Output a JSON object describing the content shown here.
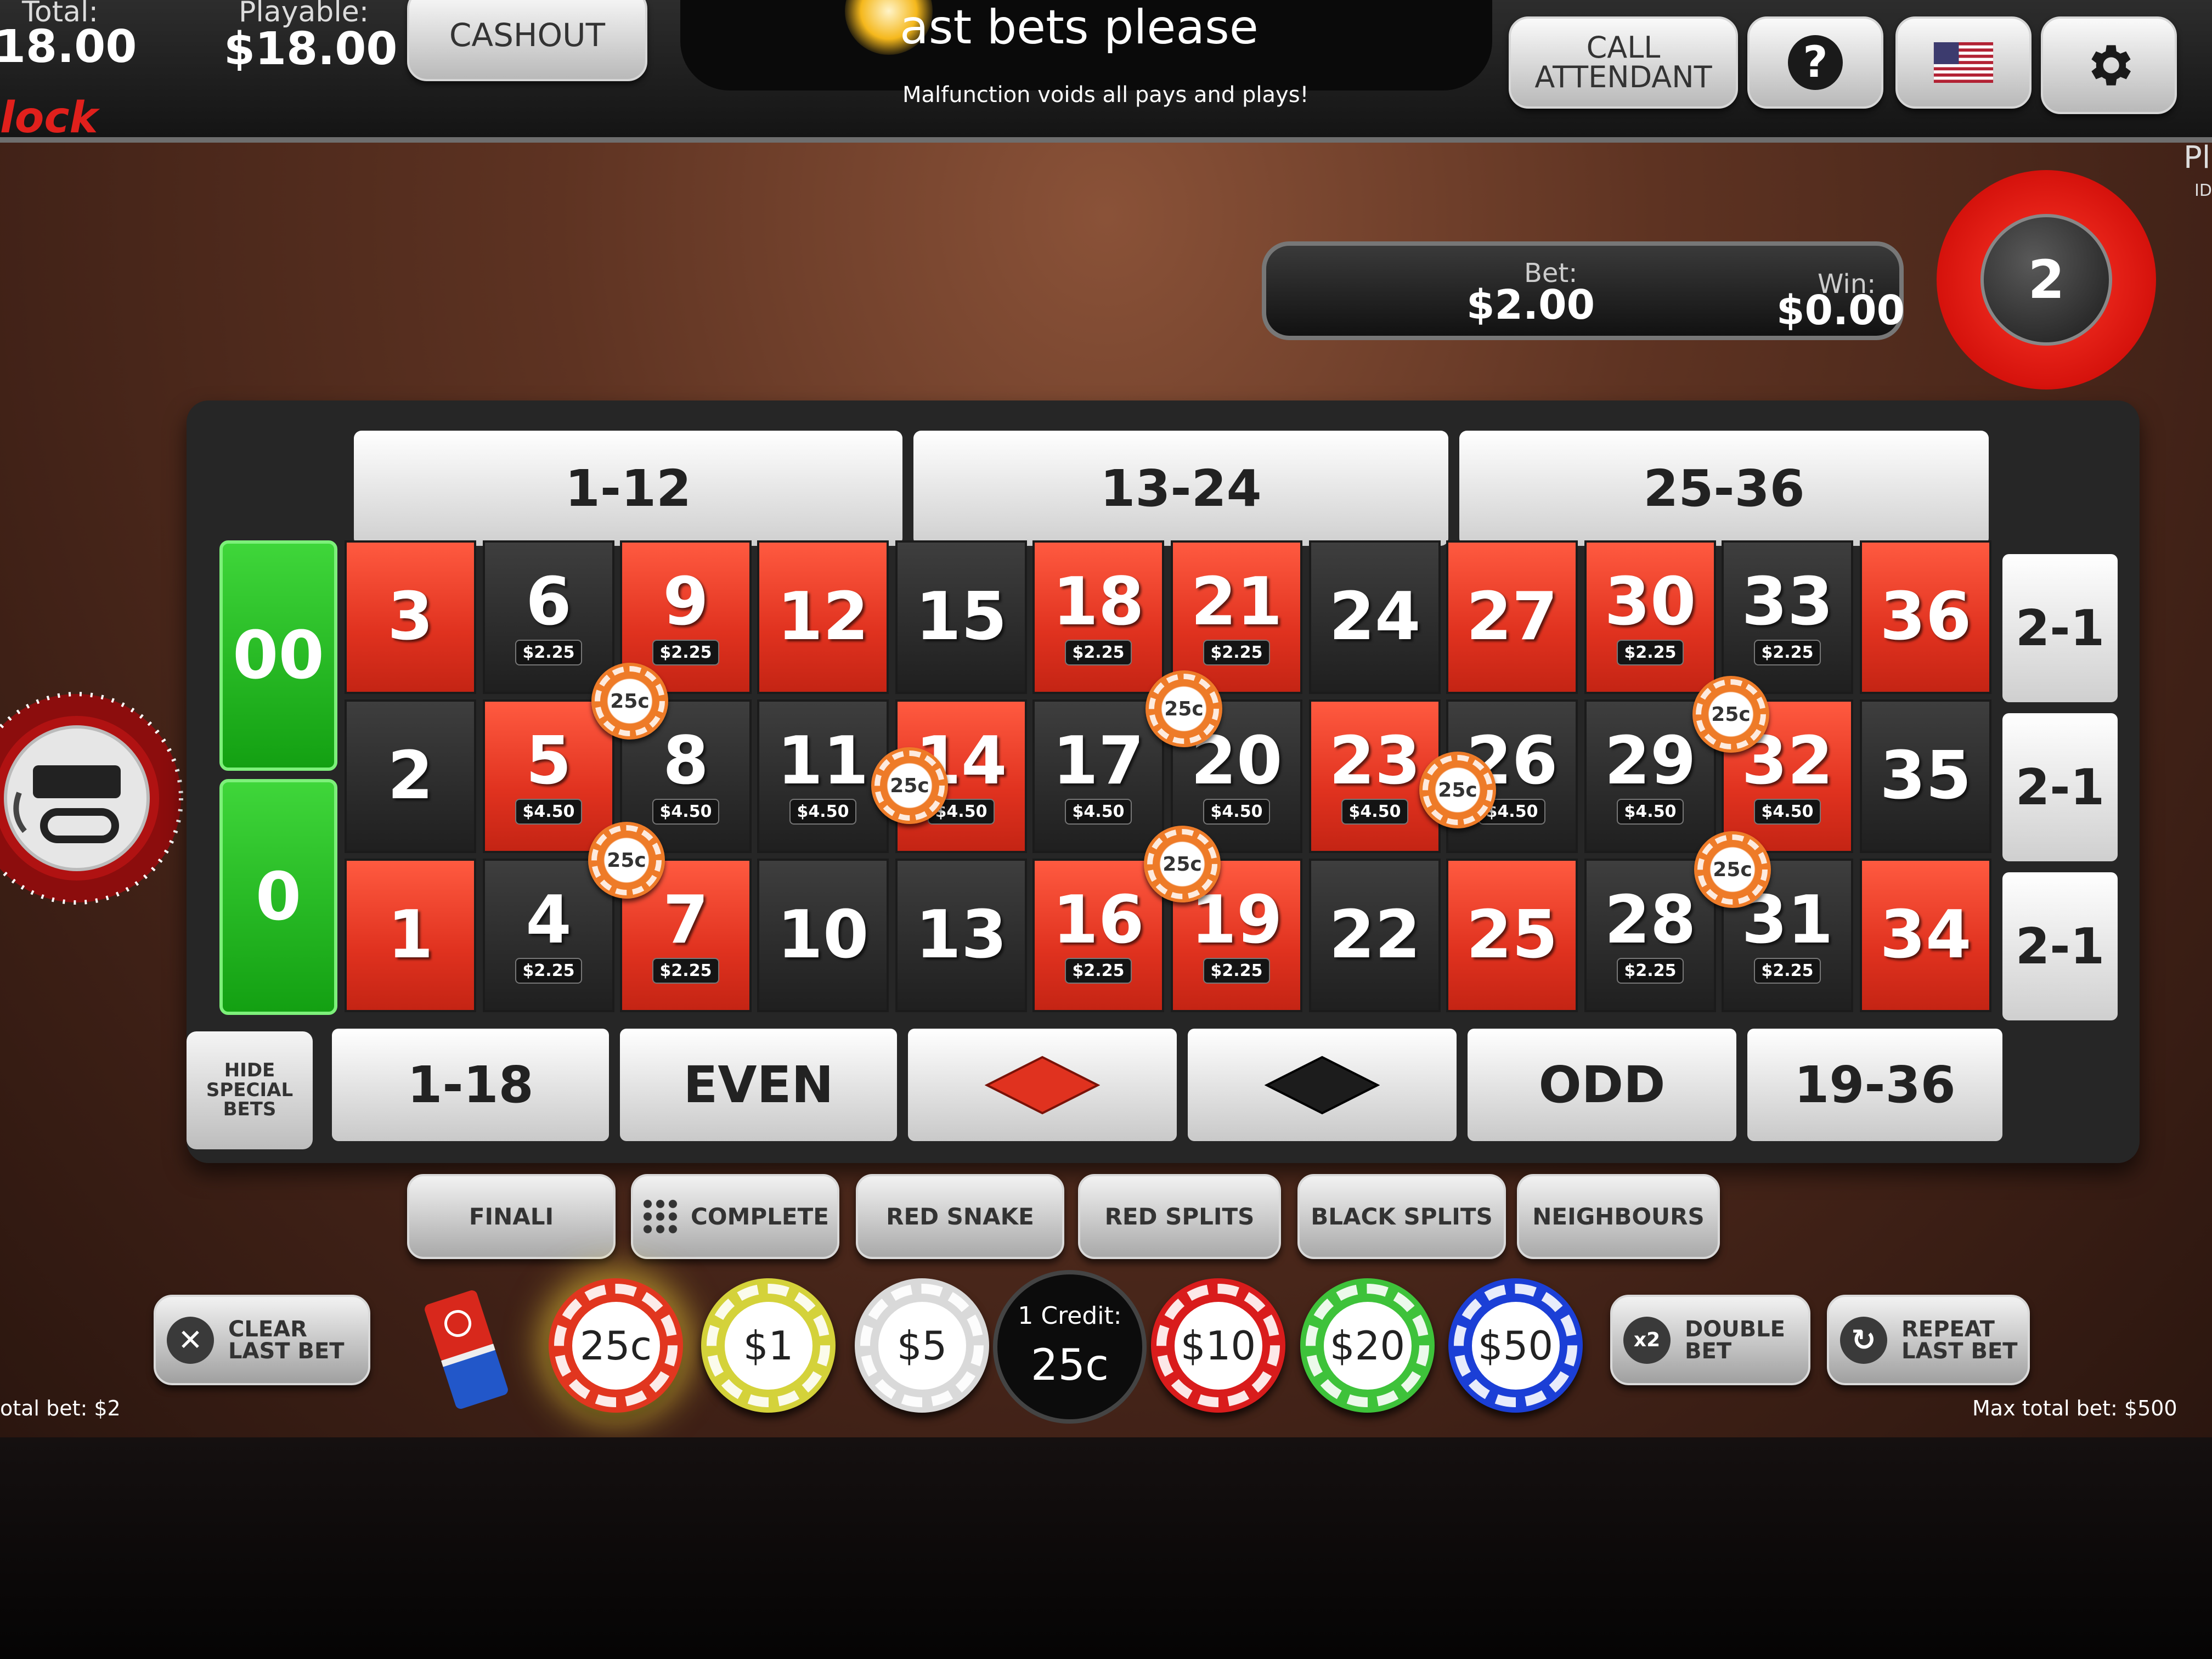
{
  "topbar": {
    "total_label": "Total:",
    "total_value": "18.00",
    "playable_label": "Playable:",
    "playable_value": "$18.00",
    "brand": "lock",
    "cashout": "CASHOUT",
    "message": "ast bets please",
    "malfunction": "Malfunction voids all pays and plays!",
    "call_attendant_line1": "CALL",
    "call_attendant_line2": "ATTENDANT",
    "help_symbol": "?",
    "language_icon": "us-flag-icon",
    "settings_icon": "gear-icon",
    "player_truncated": "Pl",
    "id_truncated": "ID"
  },
  "betwin": {
    "bet_label": "Bet:",
    "bet_value": "$2.00",
    "win_label": "Win:",
    "win_value": "$0.00"
  },
  "last_number": "2",
  "board": {
    "dozens": [
      "1-12",
      "13-24",
      "25-36"
    ],
    "zeros": [
      "00",
      "0"
    ],
    "columns": [
      "2-1",
      "2-1",
      "2-1"
    ],
    "numbers": [
      {
        "n": "3",
        "color": "red",
        "amount": ""
      },
      {
        "n": "6",
        "color": "black",
        "amount": "$2.25"
      },
      {
        "n": "9",
        "color": "red",
        "amount": "$2.25"
      },
      {
        "n": "12",
        "color": "red",
        "amount": ""
      },
      {
        "n": "15",
        "color": "black",
        "amount": ""
      },
      {
        "n": "18",
        "color": "red",
        "amount": "$2.25"
      },
      {
        "n": "21",
        "color": "red",
        "amount": "$2.25"
      },
      {
        "n": "24",
        "color": "black",
        "amount": ""
      },
      {
        "n": "27",
        "color": "red",
        "amount": ""
      },
      {
        "n": "30",
        "color": "red",
        "amount": "$2.25"
      },
      {
        "n": "33",
        "color": "black",
        "amount": "$2.25"
      },
      {
        "n": "36",
        "color": "red",
        "amount": ""
      },
      {
        "n": "2",
        "color": "black",
        "amount": ""
      },
      {
        "n": "5",
        "color": "red",
        "amount": "$4.50"
      },
      {
        "n": "8",
        "color": "black",
        "amount": "$4.50"
      },
      {
        "n": "11",
        "color": "black",
        "amount": "$4.50"
      },
      {
        "n": "14",
        "color": "red",
        "amount": "$4.50"
      },
      {
        "n": "17",
        "color": "black",
        "amount": "$4.50"
      },
      {
        "n": "20",
        "color": "black",
        "amount": "$4.50"
      },
      {
        "n": "23",
        "color": "red",
        "amount": "$4.50"
      },
      {
        "n": "26",
        "color": "black",
        "amount": "$4.50"
      },
      {
        "n": "29",
        "color": "black",
        "amount": "$4.50"
      },
      {
        "n": "32",
        "color": "red",
        "amount": "$4.50"
      },
      {
        "n": "35",
        "color": "black",
        "amount": ""
      },
      {
        "n": "1",
        "color": "red",
        "amount": ""
      },
      {
        "n": "4",
        "color": "black",
        "amount": "$2.25"
      },
      {
        "n": "7",
        "color": "red",
        "amount": "$2.25"
      },
      {
        "n": "10",
        "color": "black",
        "amount": ""
      },
      {
        "n": "13",
        "color": "black",
        "amount": ""
      },
      {
        "n": "16",
        "color": "red",
        "amount": "$2.25"
      },
      {
        "n": "19",
        "color": "red",
        "amount": "$2.25"
      },
      {
        "n": "22",
        "color": "black",
        "amount": ""
      },
      {
        "n": "25",
        "color": "red",
        "amount": ""
      },
      {
        "n": "28",
        "color": "black",
        "amount": "$2.25"
      },
      {
        "n": "31",
        "color": "black",
        "amount": "$2.25"
      },
      {
        "n": "34",
        "color": "red",
        "amount": ""
      }
    ],
    "outside": [
      "1-18",
      "EVEN",
      "ODD",
      "19-36"
    ],
    "red_bet_icon": "red-diamond-icon",
    "black_bet_icon": "black-diamond-icon",
    "hide_special": [
      "HIDE",
      "SPECIAL",
      "BETS"
    ],
    "placed_chip_label": "25c"
  },
  "special_bets": [
    "FINALI",
    "COMPLETE",
    "RED SNAKE",
    "RED SPLITS",
    "BLACK SPLITS",
    "NEIGHBOURS"
  ],
  "actions": {
    "clear_line1": "CLEAR",
    "clear_line2": "LAST BET",
    "double_line1": "DOUBLE",
    "double_line2": "BET",
    "double_icon_text": "x2",
    "repeat_line1": "REPEAT",
    "repeat_line2": "LAST BET"
  },
  "chips": [
    {
      "label": "25c",
      "color": "#e1361f"
    },
    {
      "label": "$1",
      "color": "#d4d23a"
    },
    {
      "label": "$5",
      "color": "#d9d9d9"
    },
    {
      "label": "$10",
      "color": "#d91c1c"
    },
    {
      "label": "$20",
      "color": "#3ec23a"
    },
    {
      "label": "$50",
      "color": "#1b3fd6"
    }
  ],
  "credit": {
    "label": "1 Credit:",
    "value": "25c"
  },
  "footer": {
    "total_bet": "otal bet: $2",
    "max_total_bet": "Max total bet: $500"
  },
  "colors": {
    "red": "#e0321f",
    "black": "#262626",
    "green": "#1cb01a",
    "felt": "#5e3322"
  }
}
